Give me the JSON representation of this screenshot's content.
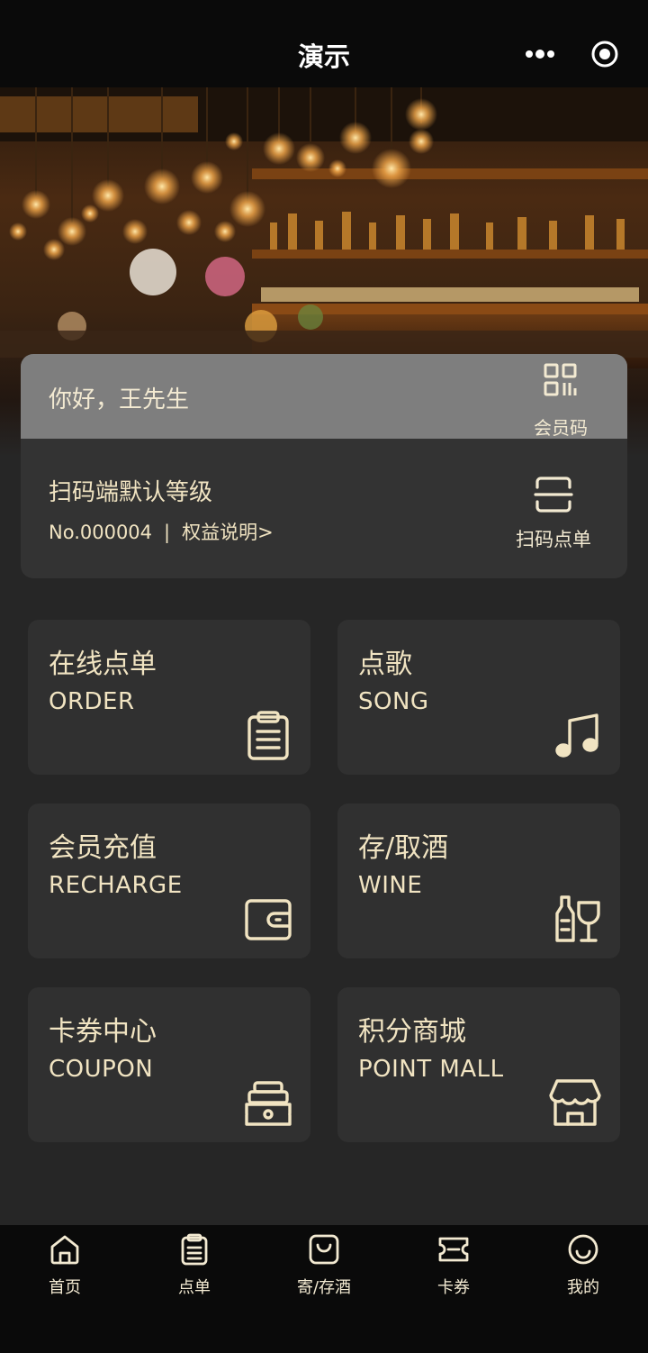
{
  "window": {
    "title": "演示"
  },
  "member_card": {
    "greeting": "你好，王先生",
    "qr_label": "会员码",
    "level": "扫码端默认等级",
    "member_no": "No.000004",
    "separator": "|",
    "benefit_link": "权益说明>",
    "scan_label": "扫码点单"
  },
  "tiles": [
    {
      "zh": "在线点单",
      "en": "ORDER",
      "icon": "clipboard-icon"
    },
    {
      "zh": "点歌",
      "en": "SONG",
      "icon": "music-note-icon"
    },
    {
      "zh": "会员充值",
      "en": "RECHARGE",
      "icon": "wallet-icon"
    },
    {
      "zh": "存/取酒",
      "en": "WINE",
      "icon": "wine-bottle-glass-icon"
    },
    {
      "zh": "卡券中心",
      "en": "COUPON",
      "icon": "coupon-icon"
    },
    {
      "zh": "积分商城",
      "en": "POINT  MALL",
      "icon": "store-icon"
    }
  ],
  "tabbar": [
    {
      "label": "首页",
      "icon": "home-icon"
    },
    {
      "label": "点单",
      "icon": "order-list-icon"
    },
    {
      "label": "寄/存酒",
      "icon": "bag-icon"
    },
    {
      "label": "卡券",
      "icon": "ticket-icon"
    },
    {
      "label": "我的",
      "icon": "smile-icon"
    }
  ],
  "colors": {
    "accent": "#f1e4c2",
    "background": "#262626",
    "card": "#303030",
    "bar": "#0a0a0a"
  }
}
